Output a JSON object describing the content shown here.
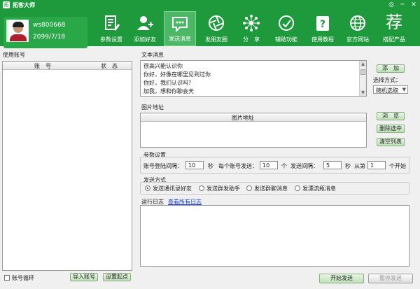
{
  "window": {
    "title": "拓客大师",
    "icon_glyph": "拓"
  },
  "profile": {
    "username": "ws800668",
    "date": "2099/7/18"
  },
  "toolbar": [
    {
      "label": "参数设置",
      "icon": "document-edit-icon"
    },
    {
      "label": "添加好友",
      "icon": "add-user-icon"
    },
    {
      "label": "发送消息",
      "icon": "chat-bubble-icon",
      "active": true
    },
    {
      "label": "发朋友圈",
      "icon": "aperture-icon"
    },
    {
      "label": "分　享",
      "icon": "network-share-icon"
    },
    {
      "label": "辅助功能",
      "icon": "assist-icon"
    },
    {
      "label": "使用教程",
      "icon": "help-book-icon"
    },
    {
      "label": "官方网站",
      "icon": "globe-icon"
    },
    {
      "label": "搭配产品",
      "icon": "recommend-icon",
      "glyph": "荐"
    }
  ],
  "accounts": {
    "label": "使用账号",
    "col_account": "账　号",
    "col_status": "状　态"
  },
  "text_msg": {
    "label": "文本消息",
    "lines": [
      "很高兴能认识你",
      "你好，好像在哪里见到过你",
      "你好，我们认识吗？",
      "加我，想和你聊会天"
    ],
    "add_button": "添　加",
    "select_label": "选择方式：",
    "select_value": "随机选取"
  },
  "image": {
    "label": "图片地址",
    "col_header": "图片地址",
    "browse_button": "浏　览",
    "delete_button": "删除选中",
    "clear_button": "清空列表"
  },
  "params": {
    "label": "参数设置",
    "login_interval_label": "账号登陆间隔：",
    "login_interval_value": "10",
    "unit_sec_1": "秒",
    "per_account_label": "每个账号发送：",
    "per_account_value": "10",
    "unit_count": "个",
    "send_interval_label": "发送间隔：",
    "send_interval_value": "5",
    "unit_sec_2": "秒",
    "start_from_label": "从第",
    "start_from_value": "1",
    "start_from_suffix": "个开始"
  },
  "send_mode": {
    "label": "发送方式",
    "options": [
      {
        "label": "发送通讯录好友",
        "selected": true
      },
      {
        "label": "发送群发助手",
        "selected": false
      },
      {
        "label": "发送群聊消息",
        "selected": false
      },
      {
        "label": "发漂流瓶消息",
        "selected": false
      }
    ]
  },
  "log": {
    "label": "运行日志",
    "view_all_link": "查看所有日志"
  },
  "bottom": {
    "loop_label": "账号循环",
    "import_button": "导入账号",
    "set_start_button": "设置起点",
    "start_send_button": "开始发送",
    "pause_send_button": "暂停发送"
  }
}
